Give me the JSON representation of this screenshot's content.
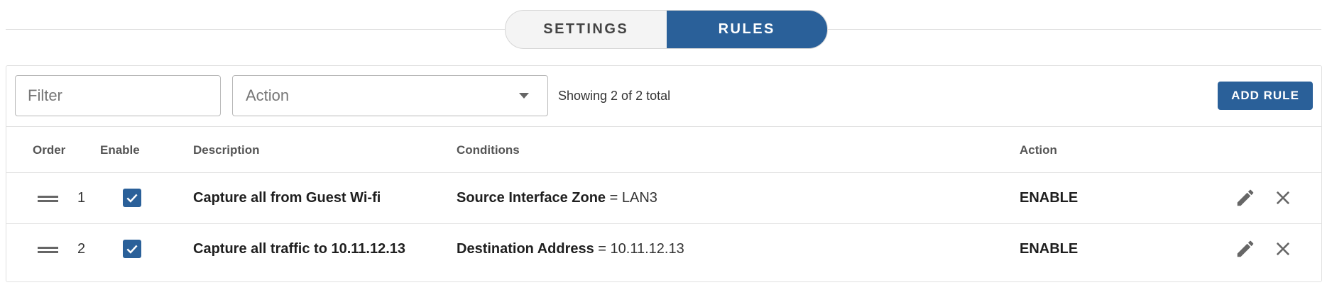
{
  "tabs": [
    {
      "label": "SETTINGS",
      "active": false
    },
    {
      "label": "RULES",
      "active": true
    }
  ],
  "toolbar": {
    "filter_placeholder": "Filter",
    "action_placeholder": "Action",
    "showing_text": "Showing 2 of 2 total",
    "add_rule_label": "ADD RULE"
  },
  "table": {
    "headers": {
      "order": "Order",
      "enable": "Enable",
      "description": "Description",
      "conditions": "Conditions",
      "action": "Action"
    },
    "rows": [
      {
        "order": "1",
        "enabled": true,
        "description": "Capture all from Guest Wi-fi",
        "condition_field": "Source Interface Zone",
        "condition_op": " = ",
        "condition_value": "LAN3",
        "action": "ENABLE"
      },
      {
        "order": "2",
        "enabled": true,
        "description": "Capture all traffic to 10.11.12.13",
        "condition_field": "Destination Address",
        "condition_op": " = ",
        "condition_value": "10.11.12.13",
        "action": "ENABLE"
      }
    ]
  },
  "icons": {
    "drag": "drag-handle-icon",
    "check": "check-icon",
    "edit": "pencil-icon",
    "delete": "close-icon",
    "dropdown": "chevron-down-icon"
  },
  "colors": {
    "accent": "#2a6099",
    "border": "#e0e0e0",
    "icon": "#666666"
  }
}
